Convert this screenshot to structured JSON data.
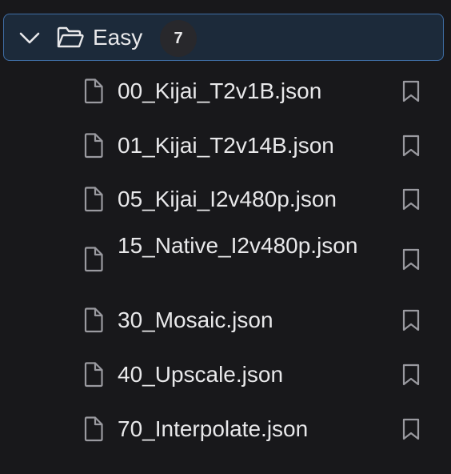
{
  "folder": {
    "name": "Easy",
    "count": "7",
    "icons": {
      "toggle": "chevron-down-icon",
      "folder": "folder-open-icon"
    }
  },
  "files": [
    {
      "name": "00_Kijai_T2v1B.json"
    },
    {
      "name": "01_Kijai_T2v14B.json"
    },
    {
      "name": "05_Kijai_I2v480p.json"
    },
    {
      "name": "15_Native_I2v480p.json"
    },
    {
      "name": "30_Mosaic.json"
    },
    {
      "name": "40_Upscale.json"
    },
    {
      "name": "70_Interpolate.json"
    }
  ],
  "icons": {
    "file": "file-icon",
    "bookmark": "bookmark-icon"
  },
  "colors": {
    "background": "#18181b",
    "header_bg": "#1c2a3a",
    "header_border": "#3f6ea6",
    "text": "#e8e8ea",
    "icon": "#9a9aa0",
    "badge_bg": "#28282c"
  }
}
